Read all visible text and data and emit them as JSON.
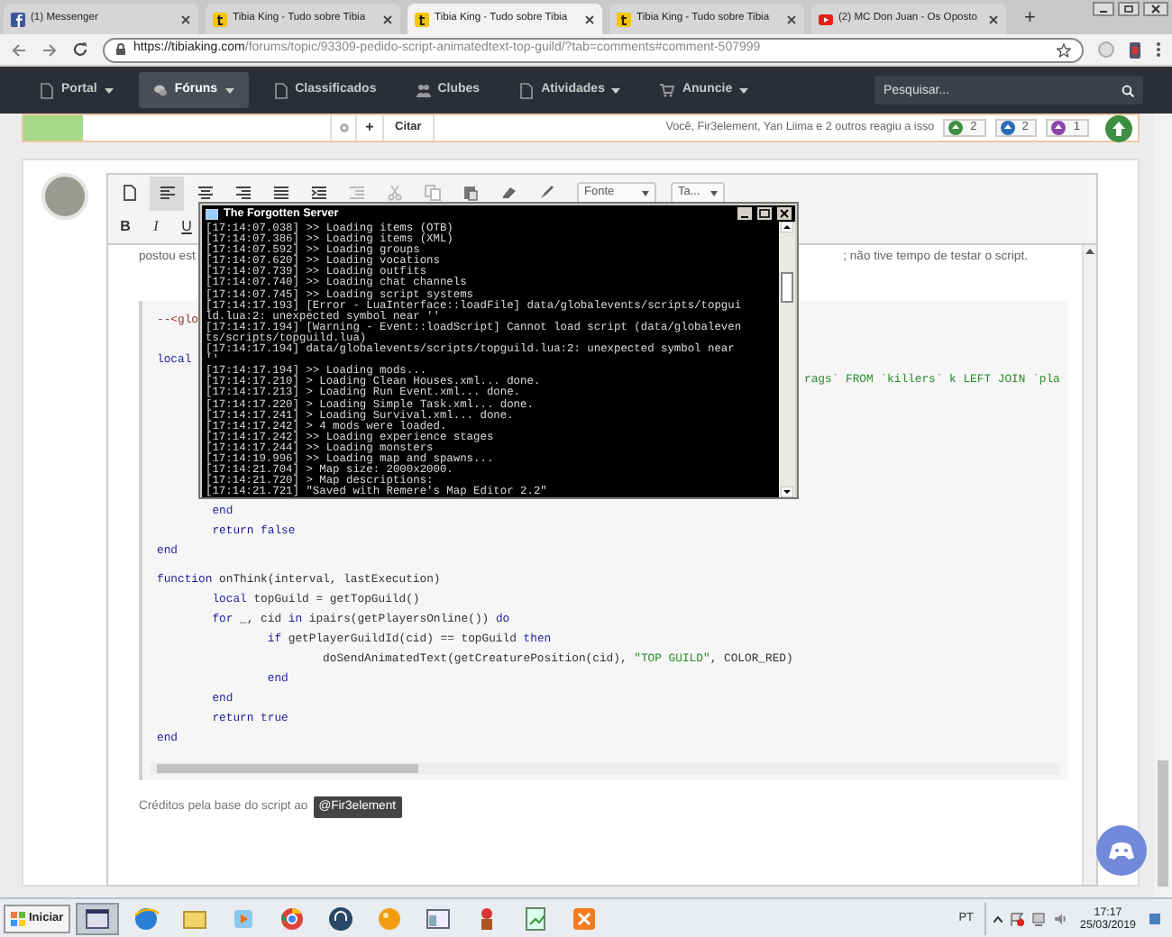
{
  "browser": {
    "tabs": [
      {
        "kind": "messenger",
        "title": "(1) Messenger",
        "selected": false
      },
      {
        "kind": "site",
        "title": "Tibia King - Tudo sobre Tibia",
        "selected": false
      },
      {
        "kind": "site",
        "title": "Tibia King - Tudo sobre Tibia",
        "selected": true
      },
      {
        "kind": "site",
        "title": "Tibia King - Tudo sobre Tibia",
        "selected": false
      },
      {
        "kind": "video",
        "title": "(2) MC Don Juan - Os Oposto",
        "selected": false
      }
    ],
    "new_tab": "+",
    "url_host": "https://tibiaking.com",
    "url_path": "/forums/topic/93309-pedido-script-animatedtext-top-guild/?tab=comments#comment-507999"
  },
  "nav": {
    "items": [
      {
        "label": "Portal",
        "dropdown": true,
        "selected": false
      },
      {
        "label": "Fóruns",
        "dropdown": true,
        "selected": true
      },
      {
        "label": "Classificados",
        "dropdown": false,
        "selected": false
      },
      {
        "label": "Clubes",
        "dropdown": false,
        "selected": false
      },
      {
        "label": "Atividades",
        "dropdown": true,
        "selected": false
      },
      {
        "label": "Anuncie",
        "dropdown": true,
        "selected": false
      }
    ],
    "search": {
      "placeholder": "Pesquisar..."
    }
  },
  "reaction_bar": {
    "plus": "+",
    "quote": "Citar",
    "summary": "Você, Fir3element, Yan Liima e 2 outros reagiu a isso",
    "reactions": [
      {
        "count": "2",
        "color": "#3e8e41"
      },
      {
        "count": "2",
        "color": "#2a6db5"
      },
      {
        "count": "1",
        "color": "#8e44ad"
      }
    ]
  },
  "editor": {
    "font_select": "Fonte",
    "size_select": "Ta...",
    "format_buttons": [
      "B",
      "I",
      "U"
    ],
    "text_left": "postou est",
    "text_right": "; não tive tempo de testar o script."
  },
  "code": {
    "groups": [
      [
        {
          "kind": "code",
          "segments": [
            {
              "kind": "comment",
              "text": "--<glo"
            }
          ]
        }
      ],
      [
        {
          "kind": "code",
          "segments": [
            {
              "kind": "keyword",
              "text": "local"
            }
          ]
        },
        {
          "kind": "fragment",
          "segments": [
            {
              "kind": "string",
              "text": "rags` FROM `killers` k LEFT JOIN `pla"
            }
          ]
        }
      ],
      [
        {
          "kind": "code",
          "segments": [
            {
              "kind": "keyword",
              "text": "\tend"
            }
          ]
        },
        {
          "kind": "code",
          "segments": [
            {
              "kind": "keyword",
              "text": "\treturn false"
            }
          ]
        },
        {
          "kind": "code",
          "segments": [
            {
              "kind": "keyword",
              "text": "end"
            }
          ]
        }
      ],
      [
        {
          "kind": "code",
          "segments": [
            {
              "kind": "keyword",
              "text": "function"
            },
            {
              "kind": "plain",
              "text": " onThink(interval, lastExecution)"
            }
          ]
        },
        {
          "kind": "code",
          "segments": [
            {
              "kind": "keyword",
              "text": "\tlocal"
            },
            {
              "kind": "plain",
              "text": " topGuild = getTopGuild()"
            }
          ]
        },
        {
          "kind": "code",
          "segments": [
            {
              "kind": "keyword",
              "text": "\tfor"
            },
            {
              "kind": "plain",
              "text": " _, cid "
            },
            {
              "kind": "keyword",
              "text": "in"
            },
            {
              "kind": "plain",
              "text": " ipairs(getPlayersOnline()) "
            },
            {
              "kind": "keyword",
              "text": "do"
            }
          ]
        },
        {
          "kind": "code",
          "segments": [
            {
              "kind": "keyword",
              "text": "\t\tif"
            },
            {
              "kind": "plain",
              "text": " getPlayerGuildId(cid) == topGuild "
            },
            {
              "kind": "keyword",
              "text": "then"
            }
          ]
        },
        {
          "kind": "code",
          "segments": [
            {
              "kind": "plain",
              "text": "\t\t\tdoSendAnimatedText(getCreaturePosition(cid), "
            },
            {
              "kind": "string",
              "text": "\"TOP GUILD\""
            },
            {
              "kind": "plain",
              "text": ", COLOR_RED)"
            }
          ]
        },
        {
          "kind": "code",
          "segments": [
            {
              "kind": "keyword",
              "text": "\t\tend"
            }
          ]
        },
        {
          "kind": "code",
          "segments": [
            {
              "kind": "keyword",
              "text": "\tend"
            }
          ]
        },
        {
          "kind": "code",
          "segments": [
            {
              "kind": "keyword",
              "text": "\treturn true"
            }
          ]
        },
        {
          "kind": "code",
          "segments": [
            {
              "kind": "keyword",
              "text": "end"
            }
          ]
        }
      ]
    ]
  },
  "credits": {
    "text": "Créditos pela base do script ao",
    "mention": "@Fir3element"
  },
  "console": {
    "title": "The Forgotten Server",
    "lines": [
      "[17:14:07.038] >> Loading items (OTB)",
      "[17:14:07.386] >> Loading items (XML)",
      "[17:14:07.592] >> Loading groups",
      "[17:14:07.620] >> Loading vocations",
      "[17:14:07.739] >> Loading outfits",
      "[17:14:07.740] >> Loading chat channels",
      "[17:14:07.745] >> Loading script systems",
      "[17:14:17.193] [Error - LuaInterface::loadFile] data/globalevents/scripts/topgui",
      "ld.lua:2: unexpected symbol near ''",
      "[17:14:17.194] [Warning - Event::loadScript] Cannot load script (data/globaleven",
      "ts/scripts/topguild.lua)",
      "[17:14:17.194] data/globalevents/scripts/topguild.lua:2: unexpected symbol near",
      "''",
      "[17:14:17.194] >> Loading mods...",
      "[17:14:17.210] > Loading Clean Houses.xml... done.",
      "[17:14:17.213] > Loading Run Event.xml... done.",
      "[17:14:17.220] > Loading Simple Task.xml... done.",
      "[17:14:17.241] > Loading Survival.xml... done.",
      "[17:14:17.242] > 4 mods were loaded.",
      "[17:14:17.242] >> Loading experience stages",
      "[17:14:17.244] >> Loading monsters",
      "[17:14:19.996] >> Loading map and spawns...",
      "[17:14:21.704] > Map size: 2000x2000.",
      "[17:14:21.720] > Map descriptions:",
      "[17:14:21.721] \"Saved with Remere's Map Editor 2.2\""
    ]
  },
  "taskbar": {
    "start": "Iniciar",
    "language": "PT",
    "time": "17:17",
    "date": "25/03/2019"
  }
}
